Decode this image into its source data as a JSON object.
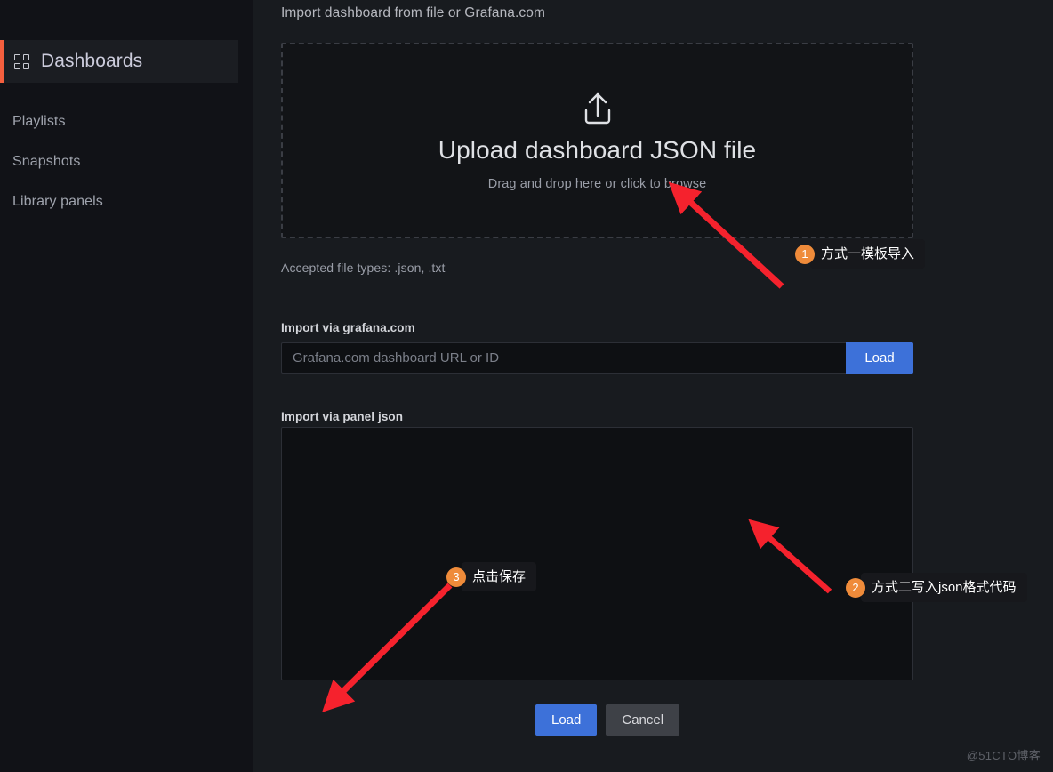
{
  "sidebar": {
    "active_item": {
      "label": "Dashboards",
      "icon": "grid-icon"
    },
    "items": [
      {
        "label": "Playlists"
      },
      {
        "label": "Snapshots"
      },
      {
        "label": "Library panels"
      }
    ]
  },
  "main": {
    "section_title": "Import dashboard from file or Grafana.com",
    "dropzone": {
      "icon": "upload-icon",
      "title": "Upload dashboard JSON file",
      "subtitle": "Drag and drop here or click to browse"
    },
    "accepted_types": "Accepted file types: .json, .txt",
    "grafana_import": {
      "label": "Import via grafana.com",
      "input_value": "",
      "input_placeholder": "Grafana.com dashboard URL or ID",
      "load_label": "Load"
    },
    "panel_json_import": {
      "label": "Import via panel json",
      "textarea_value": "",
      "textarea_placeholder": ""
    },
    "footer": {
      "load_label": "Load",
      "cancel_label": "Cancel"
    }
  },
  "annotations": [
    {
      "number": "1",
      "text": "方式一模板导入"
    },
    {
      "number": "2",
      "text": "方式二写入json格式代码"
    },
    {
      "number": "3",
      "text": "点击保存"
    }
  ],
  "watermark": "@51CTO博客",
  "colors": {
    "accent_orange": "#f55f3e",
    "primary_blue": "#3d71d9",
    "callout_orange": "#ef8b3a",
    "arrow_red": "#f5222d"
  }
}
